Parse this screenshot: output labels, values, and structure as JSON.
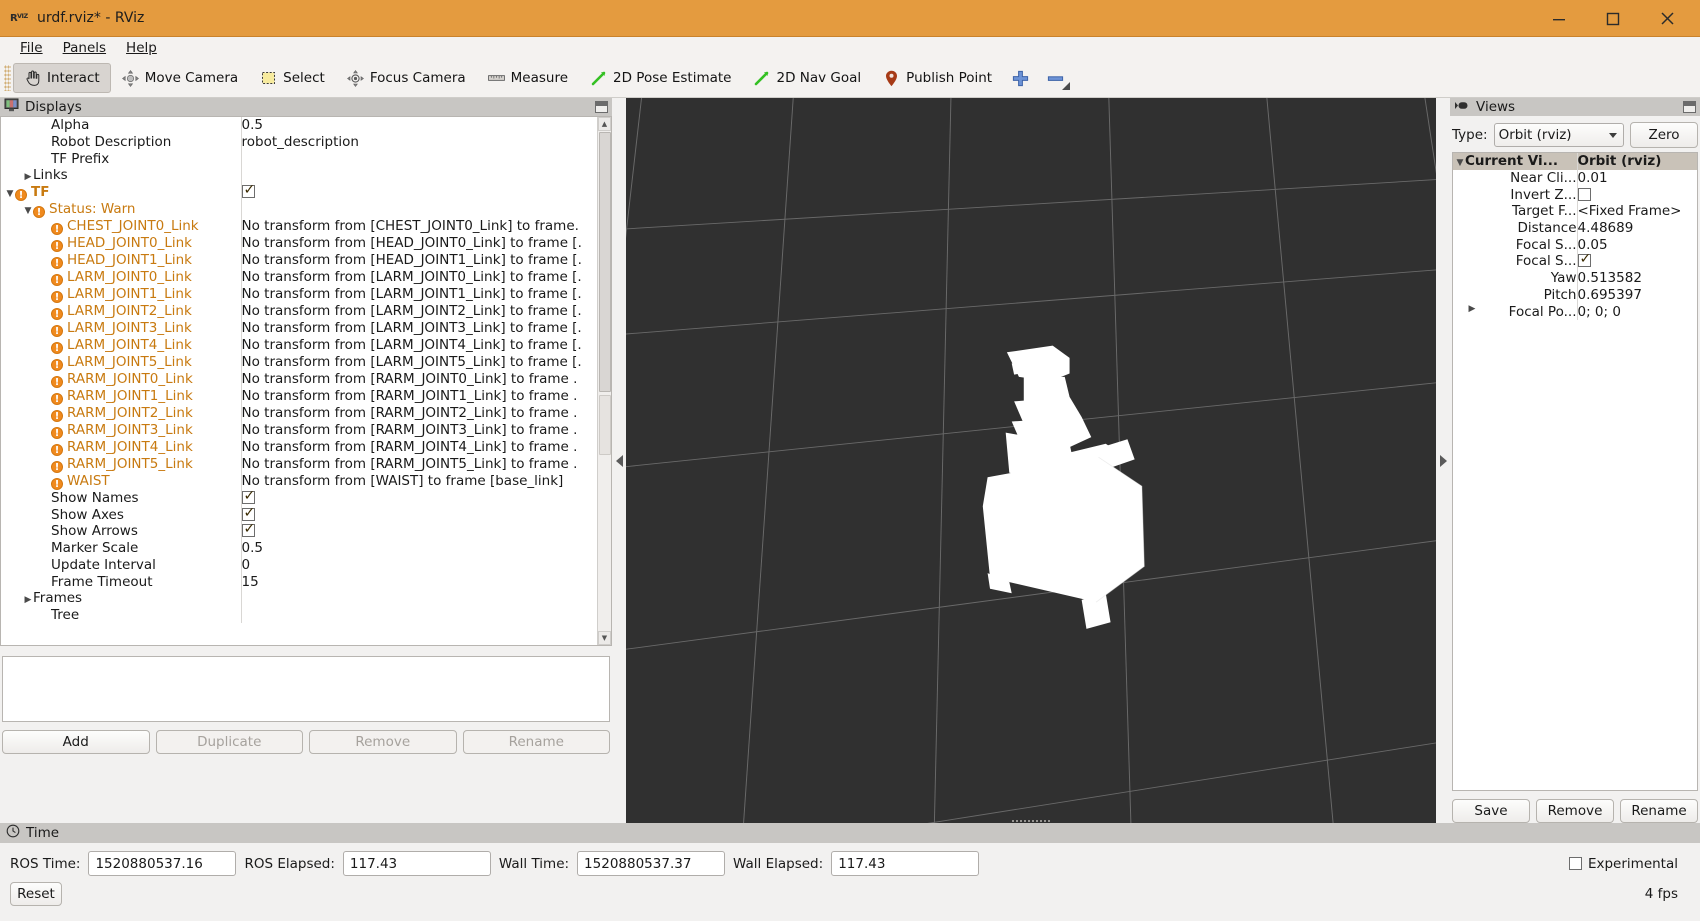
{
  "window": {
    "title": "urdf.rviz* - RViz",
    "logo_text": "RViz",
    "minimize_icon": "minimize-icon",
    "maximize_icon": "maximize-icon",
    "close_icon": "close-icon"
  },
  "menu": [
    {
      "label": "File"
    },
    {
      "label": "Panels"
    },
    {
      "label": "Help"
    }
  ],
  "toolbar": [
    {
      "label": "Interact",
      "icon": "hand-cursor-icon",
      "active": true
    },
    {
      "label": "Move Camera",
      "icon": "move-camera-icon",
      "active": false
    },
    {
      "label": "Select",
      "icon": "select-rectangle-icon",
      "active": false
    },
    {
      "label": "Focus Camera",
      "icon": "focus-camera-icon",
      "active": false
    },
    {
      "label": "Measure",
      "icon": "ruler-icon",
      "active": false
    },
    {
      "label": "2D Pose Estimate",
      "icon": "pose-arrow-icon",
      "active": false
    },
    {
      "label": "2D Nav Goal",
      "icon": "nav-goal-arrow-icon",
      "active": false
    },
    {
      "label": "Publish Point",
      "icon": "map-pin-icon",
      "active": false
    },
    {
      "label": "",
      "icon": "plus-icon",
      "active": false
    },
    {
      "label": "",
      "icon": "minus-icon",
      "active": false
    }
  ],
  "displays": {
    "header": "Displays",
    "header_icon": "display-monitor-icon",
    "rows": [
      {
        "indent": 2,
        "name": "Alpha",
        "value": "0.5",
        "kind": "text"
      },
      {
        "indent": 2,
        "name": "Robot Description",
        "value": "robot_description",
        "kind": "text"
      },
      {
        "indent": 2,
        "name": "TF Prefix",
        "value": "",
        "kind": "text"
      },
      {
        "indent": 1,
        "arrow": "right",
        "name": "Links",
        "value": "",
        "kind": "text"
      },
      {
        "indent": 0,
        "arrow": "down",
        "warn": true,
        "bold": true,
        "name": "TF",
        "value": "",
        "kind": "check",
        "checked": true
      },
      {
        "indent": 1,
        "arrow": "down",
        "warn": true,
        "name": "Status: Warn",
        "value": "",
        "kind": "text"
      },
      {
        "indent": 2,
        "warn": true,
        "name": "CHEST_JOINT0_Link",
        "value": "No transform from [CHEST_JOINT0_Link] to frame.",
        "kind": "text"
      },
      {
        "indent": 2,
        "warn": true,
        "name": "HEAD_JOINT0_Link",
        "value": "No transform from [HEAD_JOINT0_Link] to frame [.",
        "kind": "text"
      },
      {
        "indent": 2,
        "warn": true,
        "name": "HEAD_JOINT1_Link",
        "value": "No transform from [HEAD_JOINT1_Link] to frame [.",
        "kind": "text"
      },
      {
        "indent": 2,
        "warn": true,
        "name": "LARM_JOINT0_Link",
        "value": "No transform from [LARM_JOINT0_Link] to frame [.",
        "kind": "text"
      },
      {
        "indent": 2,
        "warn": true,
        "name": "LARM_JOINT1_Link",
        "value": "No transform from [LARM_JOINT1_Link] to frame [.",
        "kind": "text"
      },
      {
        "indent": 2,
        "warn": true,
        "name": "LARM_JOINT2_Link",
        "value": "No transform from [LARM_JOINT2_Link] to frame [.",
        "kind": "text"
      },
      {
        "indent": 2,
        "warn": true,
        "name": "LARM_JOINT3_Link",
        "value": "No transform from [LARM_JOINT3_Link] to frame [.",
        "kind": "text"
      },
      {
        "indent": 2,
        "warn": true,
        "name": "LARM_JOINT4_Link",
        "value": "No transform from [LARM_JOINT4_Link] to frame [.",
        "kind": "text"
      },
      {
        "indent": 2,
        "warn": true,
        "name": "LARM_JOINT5_Link",
        "value": "No transform from [LARM_JOINT5_Link] to frame [.",
        "kind": "text"
      },
      {
        "indent": 2,
        "warn": true,
        "name": "RARM_JOINT0_Link",
        "value": "No transform from [RARM_JOINT0_Link] to frame .",
        "kind": "text"
      },
      {
        "indent": 2,
        "warn": true,
        "name": "RARM_JOINT1_Link",
        "value": "No transform from [RARM_JOINT1_Link] to frame .",
        "kind": "text"
      },
      {
        "indent": 2,
        "warn": true,
        "name": "RARM_JOINT2_Link",
        "value": "No transform from [RARM_JOINT2_Link] to frame .",
        "kind": "text"
      },
      {
        "indent": 2,
        "warn": true,
        "name": "RARM_JOINT3_Link",
        "value": "No transform from [RARM_JOINT3_Link] to frame .",
        "kind": "text"
      },
      {
        "indent": 2,
        "warn": true,
        "name": "RARM_JOINT4_Link",
        "value": "No transform from [RARM_JOINT4_Link] to frame .",
        "kind": "text"
      },
      {
        "indent": 2,
        "warn": true,
        "name": "RARM_JOINT5_Link",
        "value": "No transform from [RARM_JOINT5_Link] to frame .",
        "kind": "text"
      },
      {
        "indent": 2,
        "warn": true,
        "name": "WAIST",
        "value": "No transform from [WAIST] to frame [base_link]",
        "kind": "text"
      },
      {
        "indent": 2,
        "name": "Show Names",
        "value": "",
        "kind": "check",
        "checked": true
      },
      {
        "indent": 2,
        "name": "Show Axes",
        "value": "",
        "kind": "check",
        "checked": true
      },
      {
        "indent": 2,
        "name": "Show Arrows",
        "value": "",
        "kind": "check",
        "checked": true
      },
      {
        "indent": 2,
        "name": "Marker Scale",
        "value": "0.5",
        "kind": "text"
      },
      {
        "indent": 2,
        "name": "Update Interval",
        "value": "0",
        "kind": "text"
      },
      {
        "indent": 2,
        "name": "Frame Timeout",
        "value": "15",
        "kind": "text"
      },
      {
        "indent": 1,
        "arrow": "right",
        "name": "Frames",
        "value": "",
        "kind": "text"
      },
      {
        "indent": 2,
        "name": "Tree",
        "value": "",
        "kind": "text"
      }
    ],
    "buttons": [
      {
        "label": "Add",
        "enabled": true
      },
      {
        "label": "Duplicate",
        "enabled": false
      },
      {
        "label": "Remove",
        "enabled": false
      },
      {
        "label": "Rename",
        "enabled": false
      }
    ]
  },
  "views": {
    "header": "Views",
    "header_icon": "camera-view-icon",
    "type_label": "Type:",
    "type_value": "Orbit (rviz)",
    "zero_button": "Zero",
    "tree_head": {
      "name": "Current Vi...",
      "value": "Orbit (rviz)"
    },
    "rows": [
      {
        "name": "Near Cli...",
        "value": "0.01",
        "kind": "text"
      },
      {
        "name": "Invert Z...",
        "value": "",
        "kind": "check",
        "checked": false
      },
      {
        "name": "Target F...",
        "value": "<Fixed Frame>",
        "kind": "text"
      },
      {
        "name": "Distance",
        "value": "4.48689",
        "kind": "text"
      },
      {
        "name": "Focal S...",
        "value": "0.05",
        "kind": "text"
      },
      {
        "name": "Focal S...",
        "value": "",
        "kind": "check",
        "checked": true
      },
      {
        "name": "Yaw",
        "value": "0.513582",
        "kind": "text"
      },
      {
        "name": "Pitch",
        "value": "0.695397",
        "kind": "text"
      },
      {
        "name": "Focal Po...",
        "value": "0; 0; 0",
        "kind": "text",
        "arrow": "right"
      }
    ],
    "buttons": [
      {
        "label": "Save",
        "enabled": true
      },
      {
        "label": "Remove",
        "enabled": true
      },
      {
        "label": "Rename",
        "enabled": true
      }
    ]
  },
  "time": {
    "header": "Time",
    "header_icon": "clock-icon",
    "fields": [
      {
        "label": "ROS Time:",
        "value": "1520880537.16"
      },
      {
        "label": "ROS Elapsed:",
        "value": "117.43"
      },
      {
        "label": "Wall Time:",
        "value": "1520880537.37"
      },
      {
        "label": "Wall Elapsed:",
        "value": "117.43"
      }
    ],
    "experimental_label": "Experimental",
    "experimental_checked": false,
    "reset_button": "Reset",
    "fps": "4 fps"
  },
  "colors": {
    "titlebar": "#e49b3f",
    "warn": "#c87a10",
    "warn_dot": "#f08a1e",
    "viewport_bg": "#303030",
    "panel_header": "#c8c6c3"
  }
}
